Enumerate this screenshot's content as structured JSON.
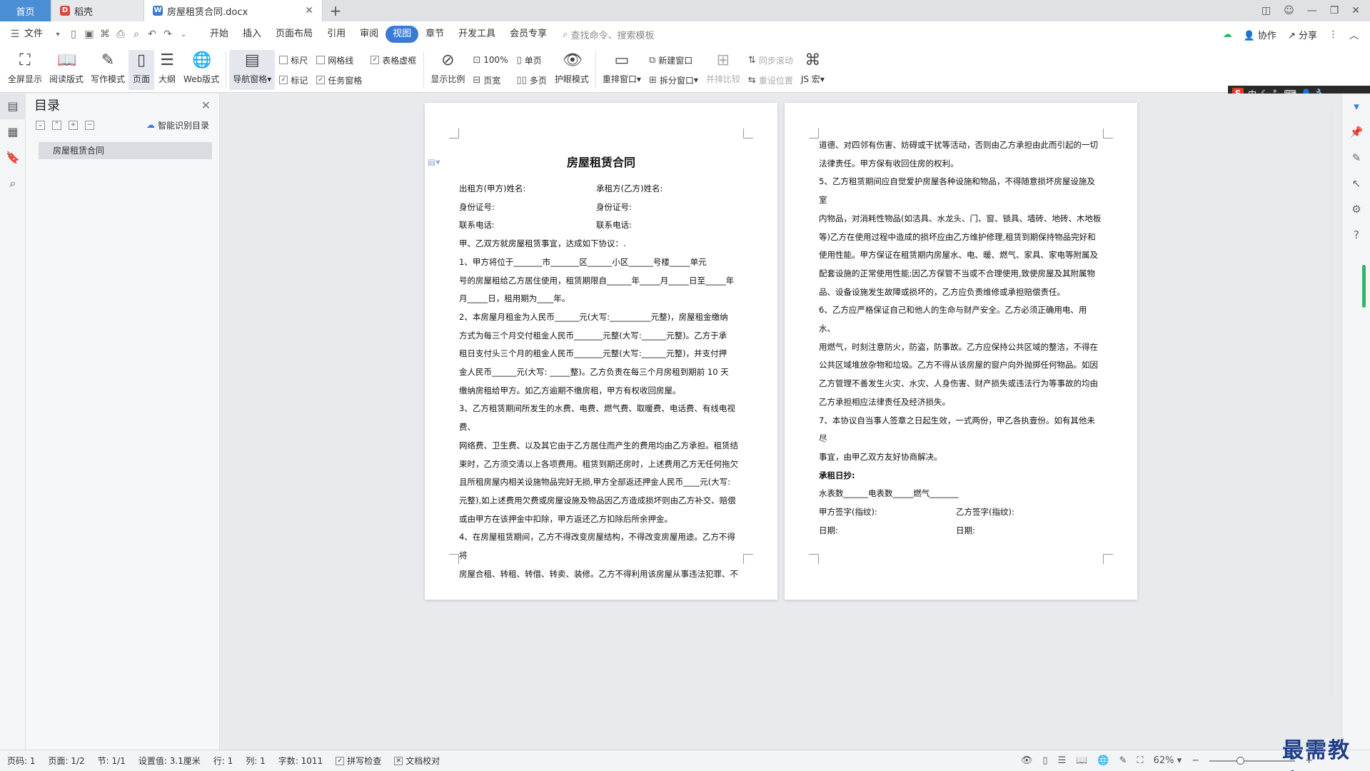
{
  "tabs": {
    "home": "首页",
    "daoke": "稻壳",
    "doc": "房屋租赁合同.docx",
    "add": "+"
  },
  "menu": {
    "file": "文件",
    "items": [
      "开始",
      "插入",
      "页面布局",
      "引用",
      "审阅",
      "视图",
      "章节",
      "开发工具",
      "会员专享"
    ],
    "active_index": 5,
    "search_placeholder": "查找命令、搜索模板",
    "collab": "协作",
    "share": "分享"
  },
  "ribbon": {
    "fullscreen": "全屏显示",
    "reading": "阅读版式",
    "writing": "写作模式",
    "page": "页面",
    "outline": "大纲",
    "web": "Web版式",
    "navpane": "导航窗格",
    "ruler": "标尺",
    "gridlines": "网格线",
    "tableframe": "表格虚框",
    "markup": "标记",
    "taskpane": "任务窗格",
    "zoomratio": "显示比例",
    "zoom100": "100%",
    "pagewidth": "页宽",
    "singlepage": "单页",
    "multipage": "多页",
    "eyecare": "护眼模式",
    "arrange": "重排窗口",
    "newwindow": "新建窗口",
    "splitwindow": "拆分窗口",
    "sidebyside": "并排比较",
    "syncscroll": "同步滚动",
    "resetpos": "重设位置",
    "jsmacro": "JS 宏"
  },
  "toc": {
    "title": "目录",
    "smart": "智能识别目录",
    "items": [
      "房屋租赁合同"
    ]
  },
  "page1": {
    "title": "房屋租赁合同",
    "party_a_name": "出租方(甲方)姓名:",
    "party_b_name": "承租方(乙方)姓名:",
    "id_a": "身份证号:",
    "id_b": "身份证号:",
    "tel_a": "联系电话:",
    "tel_b": "联系电话:",
    "lines": [
      "甲、乙双方就房屋租赁事宜，达成如下协议：.",
      "1、甲方将位于_______市_______区______小区______号楼_____单元",
      "号的房屋租给乙方居住使用，租赁期限自______年_____月_____日至_____年",
      "月_____日，租用期为____年。",
      "2、本房屋月租金为人民币______元(大写:__________元整)，房屋租金缴纳",
      "方式为每三个月交付租金人民币_______元整(大写:______元整)。乙方于承",
      "租日支付头三个月的租金人民币_______元整(大写:______元整)，并支付押",
      "金人民币______元(大写:    _____整)。乙方负责在每三个月房租到期前 10 天",
      "缴纳房租给甲方。如乙方逾期不缴房租，甲方有权收回房屋。",
      "3、乙方租赁期间所发生的水费、电费、燃气费、取暖费、电话费、有线电视费、",
      "网络费、卫生费、以及其它由于乙方居住而产生的费用均由乙方承担。租赁结",
      "束时，乙方须交清以上各项费用。租赁到期还房时，上述费用乙方无任何拖欠",
      "且所租房屋内相关设施物品完好无损,甲方全部返还押金人民币____元(大写:",
      "元整),如上述费用欠费或房屋设施及物品因乙方造成损坏则由乙方补交、赔偿",
      "或由甲方在该押金中扣除，甲方返还乙方扣除后所余押金。",
      "4、在房屋租赁期间，乙方不得改变房屋结构，不得改变房屋用途。乙方不得将",
      "房屋合租、转租、转借、转卖、装修。乙方不得利用该房屋从事违法犯罪、不"
    ]
  },
  "page2": {
    "lines": [
      "道德、对四邻有伤害、妨碍或干扰等活动，否则由乙方承担由此而引起的一切",
      "法律责任。甲方保有收回住房的权利。",
      "5、乙方租赁期间应自觉爱护房屋各种设施和物品，不得随意损坏房屋设施及室",
      "内物品，对消耗性物品(如洁具、水龙头、门、窗、锁具、墙砖、地砖、木地板",
      "等)乙方在使用过程中造成的损坏应由乙方维护修理,租赁到期保持物品完好和",
      "使用性能。甲方保证在租赁期内房屋水、电、暖、燃气、家具、家电等附属及",
      "配套设施的正常使用性能;因乙方保管不当或不合理使用,致使房屋及其附属物",
      "品、设备设施发生故障或损坏的，乙方应负责维修或承担赔偿责任。",
      "6、乙方应严格保证自己和他人的生命与财产安全。乙方必须正确用电、用水、",
      "用燃气，时刻注意防火，防盗，防事故。乙方应保持公共区域的整洁，不得在",
      "公共区域堆放杂物和垃圾。乙方不得从该房屋的窗户向外抛掷任何物品。如因",
      "乙方管理不善发生火灾、水灾、人身伤害、财产损失或违法行为等事故的均由",
      "乙方承担相应法律责任及经济损失。",
      "7、本协议自当事人签章之日起生效，一式两份，甲乙各执壹份。如有其他未尽",
      "事宜，由甲乙双方友好协商解决。"
    ],
    "handover": "承租日抄:",
    "meters": "水表数______电表数_____燃气_______",
    "sign_a": "甲方签字(指纹):",
    "sign_b": "乙方签字(指纹):",
    "date_a": "日期:",
    "date_b": "日期:"
  },
  "status": {
    "page": "页码: 1",
    "pages": "页面: 1/2",
    "section": "节: 1/1",
    "setting": "设置值: 3.1厘米",
    "row": "行: 1",
    "col": "列: 1",
    "words": "字数: 1011",
    "spell": "拼写检查",
    "proof": "文档校对",
    "zoom": "62%"
  },
  "ime": {
    "s": "S",
    "lang": "中"
  },
  "watermark": "最需教育"
}
